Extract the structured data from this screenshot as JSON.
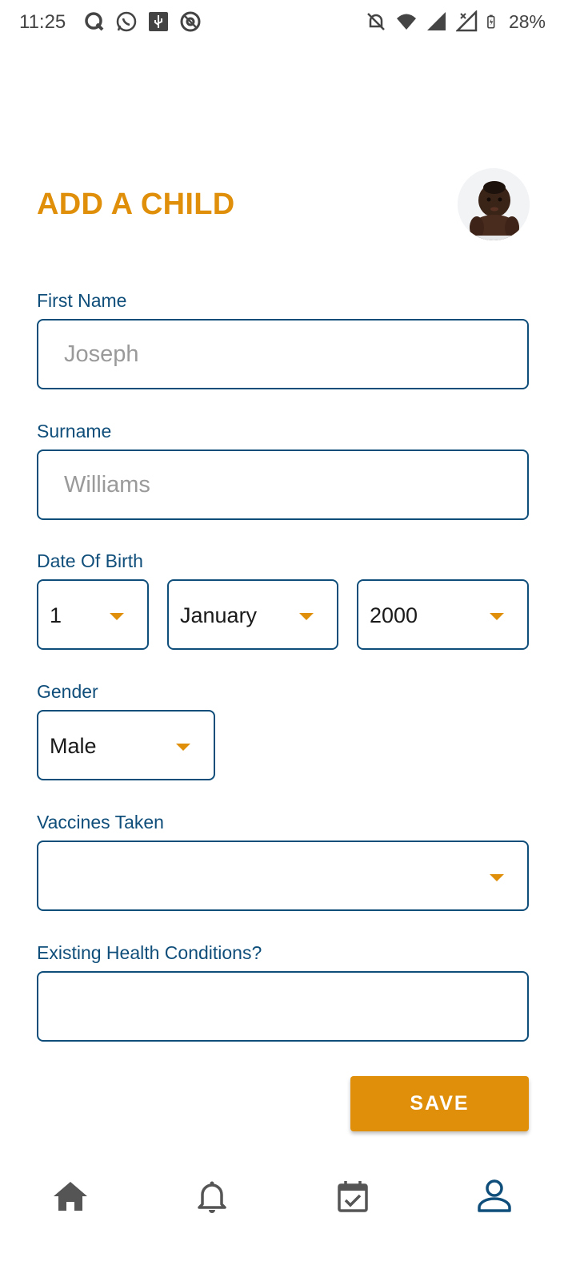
{
  "status_bar": {
    "time": "11:25",
    "battery_percent": "28%",
    "left_icons": [
      "q-app-icon",
      "whatsapp-icon",
      "usb-debug-icon",
      "at-sign-icon"
    ],
    "right_icons": [
      "silent-bell-icon",
      "wifi-icon",
      "signal-icon",
      "signal-no-data-icon",
      "battery-charging-icon"
    ]
  },
  "header": {
    "title": "ADD A CHILD",
    "avatar_icon": "baby-avatar"
  },
  "form": {
    "first_name": {
      "label": "First Name",
      "placeholder": "Joseph"
    },
    "surname": {
      "label": "Surname",
      "placeholder": "Williams"
    },
    "dob": {
      "label": "Date Of Birth",
      "day": "1",
      "month": "January",
      "year": "2000"
    },
    "gender": {
      "label": "Gender",
      "value": "Male"
    },
    "vaccines": {
      "label": "Vaccines Taken",
      "value": ""
    },
    "health": {
      "label": "Existing Health Conditions?",
      "value": ""
    },
    "save_label": "SAVE"
  },
  "bottom_nav": {
    "items": [
      "home-icon",
      "bell-icon",
      "calendar-check-icon",
      "profile-icon"
    ],
    "active": "profile-icon"
  },
  "colors": {
    "accent": "#df8f0a",
    "primary": "#0f4e7a",
    "nav_inactive": "#555555"
  }
}
